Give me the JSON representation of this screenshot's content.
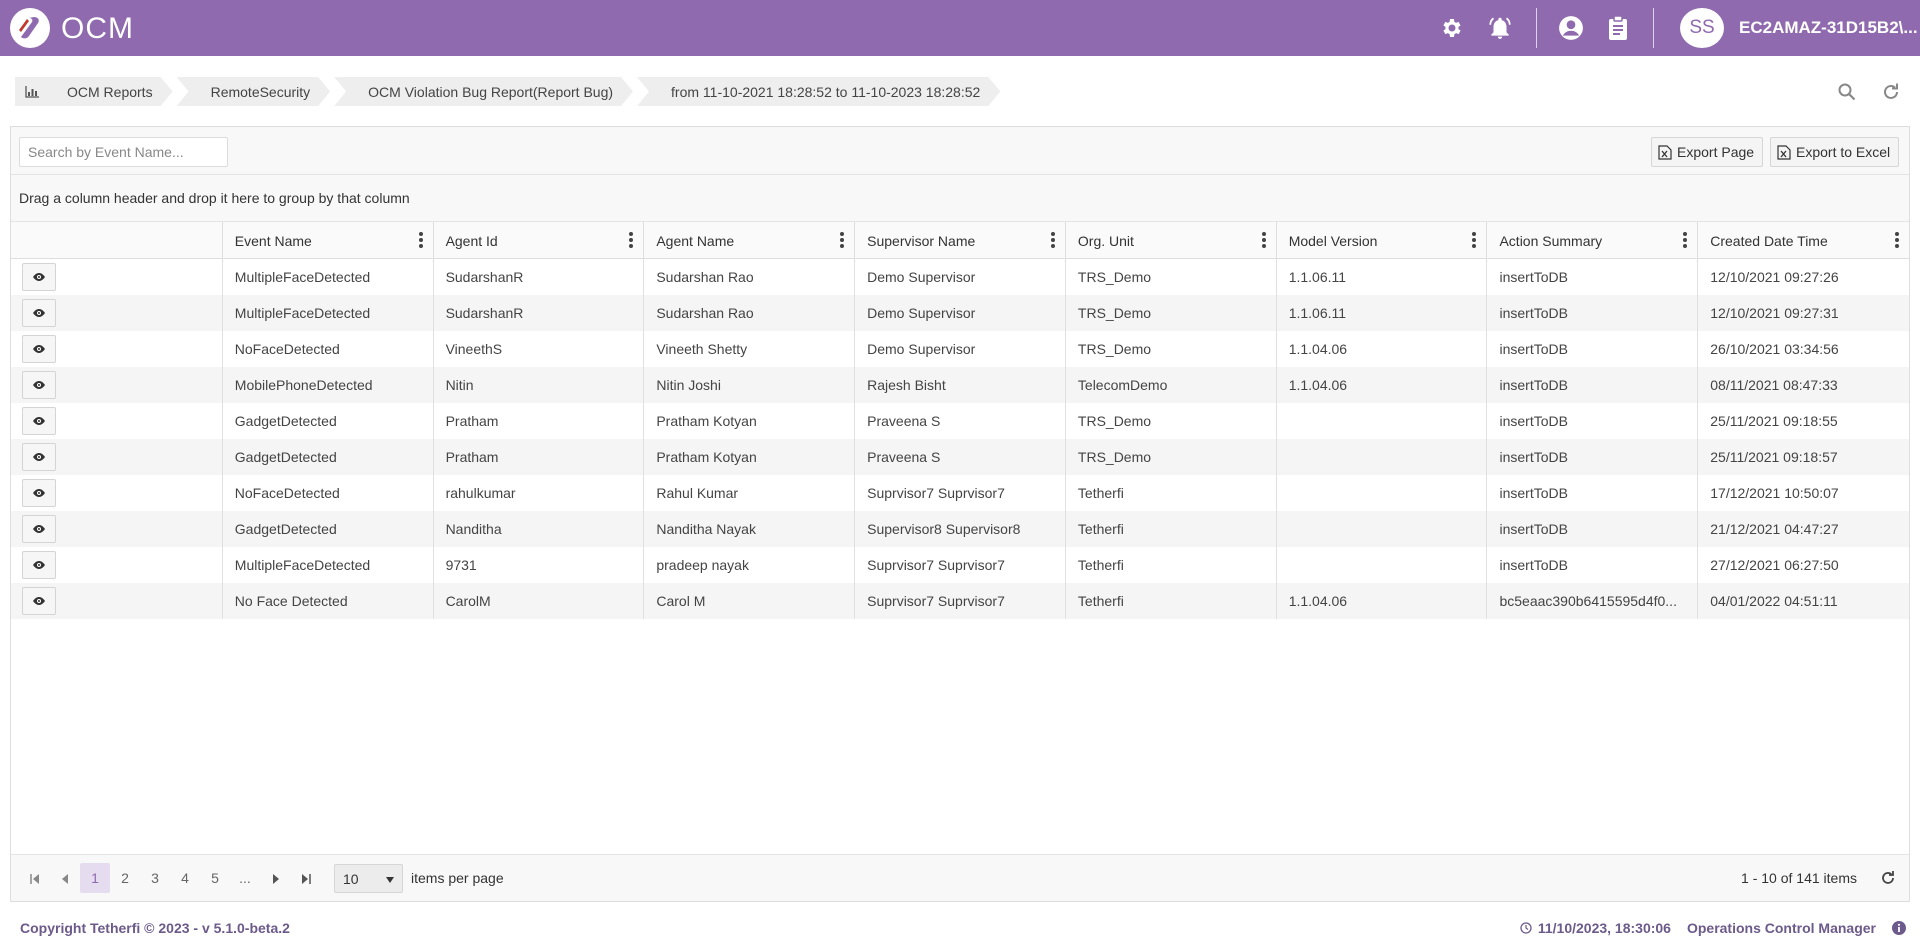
{
  "app": {
    "name": "OCM",
    "brand_color": "#8f6aae"
  },
  "header": {
    "icons": [
      "gear-icon",
      "bell-icon",
      "user-circle-icon",
      "clipboard-icon"
    ],
    "avatar_initials": "SS",
    "username": "EC2AMAZ-31D15B2\\..."
  },
  "breadcrumb": {
    "items": [
      "OCM Reports",
      "RemoteSecurity",
      "OCM Violation Bug Report(Report Bug)",
      "from 11-10-2021 18:28:52 to 11-10-2023 18:28:52"
    ]
  },
  "toolbar": {
    "search_placeholder": "Search by Event Name...",
    "export_page": "Export Page",
    "export_excel": "Export to Excel"
  },
  "group_panel_text": "Drag a column header and drop it here to group by that column",
  "columns": [
    "",
    "Event Name",
    "Agent Id",
    "Agent Name",
    "Supervisor Name",
    "Org. Unit",
    "Model Version",
    "Action Summary",
    "Created Date Time"
  ],
  "rows": [
    [
      "MultipleFaceDetected",
      "SudarshanR",
      "Sudarshan Rao",
      "Demo Supervisor",
      "TRS_Demo",
      "1.1.06.11",
      "insertToDB",
      "12/10/2021 09:27:26"
    ],
    [
      "MultipleFaceDetected",
      "SudarshanR",
      "Sudarshan Rao",
      "Demo Supervisor",
      "TRS_Demo",
      "1.1.06.11",
      "insertToDB",
      "12/10/2021 09:27:31"
    ],
    [
      "NoFaceDetected",
      "VineethS",
      "Vineeth Shetty",
      "Demo Supervisor",
      "TRS_Demo",
      "1.1.04.06",
      "insertToDB",
      "26/10/2021 03:34:56"
    ],
    [
      "MobilePhoneDetected",
      "Nitin",
      "Nitin Joshi",
      "Rajesh Bisht",
      "TelecomDemo",
      "1.1.04.06",
      "insertToDB",
      "08/11/2021 08:47:33"
    ],
    [
      "GadgetDetected",
      "Pratham",
      "Pratham Kotyan",
      "Praveena S",
      "TRS_Demo",
      "",
      "insertToDB",
      "25/11/2021 09:18:55"
    ],
    [
      "GadgetDetected",
      "Pratham",
      "Pratham Kotyan",
      "Praveena S",
      "TRS_Demo",
      "",
      "insertToDB",
      "25/11/2021 09:18:57"
    ],
    [
      "NoFaceDetected",
      "rahulkumar",
      "Rahul Kumar",
      "Suprvisor7 Suprvisor7",
      "Tetherfi",
      "",
      "insertToDB",
      "17/12/2021 10:50:07"
    ],
    [
      "GadgetDetected",
      "Nanditha",
      "Nanditha Nayak",
      "Supervisor8 Supervisor8",
      "Tetherfi",
      "",
      "insertToDB",
      "21/12/2021 04:47:27"
    ],
    [
      "MultipleFaceDetected",
      "9731",
      "pradeep nayak",
      "Suprvisor7 Suprvisor7",
      "Tetherfi",
      "",
      "insertToDB",
      "27/12/2021 06:27:50"
    ],
    [
      "No Face Detected",
      "CarolM",
      "Carol M",
      "Suprvisor7 Suprvisor7",
      "Tetherfi",
      "1.1.04.06",
      "bc5eaac390b6415595d4f0...",
      "04/01/2022 04:51:11"
    ]
  ],
  "pager": {
    "pages": [
      "1",
      "2",
      "3",
      "4",
      "5",
      "..."
    ],
    "current_page": "1",
    "page_size": "10",
    "items_per_page_label": "items per page",
    "info": "1 - 10 of 141 items"
  },
  "footer": {
    "copyright": "Copyright Tetherfi © 2023 - v 5.1.0-beta.2",
    "datetime": "11/10/2023, 18:30:06",
    "product": "Operations Control Manager"
  }
}
